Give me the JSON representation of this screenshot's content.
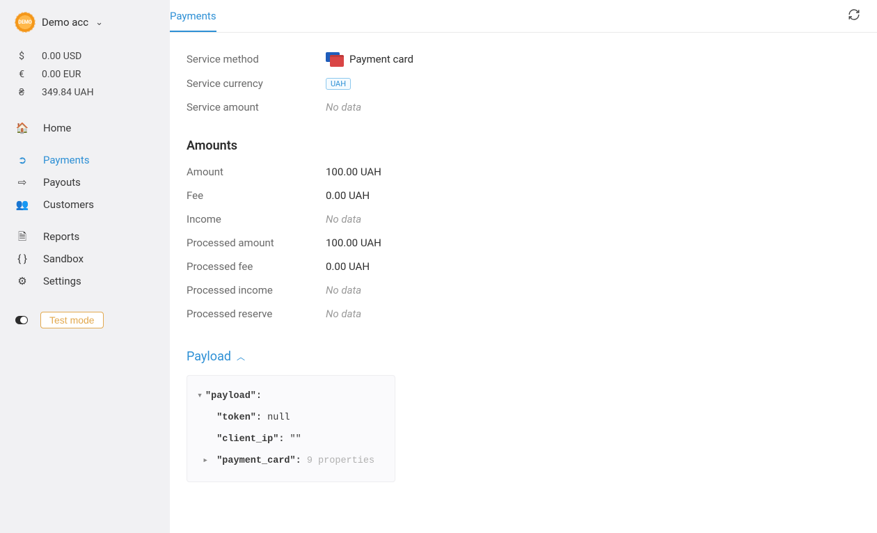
{
  "account": {
    "name": "Demo acc"
  },
  "balances": [
    {
      "icon": "$",
      "text": "0.00 USD"
    },
    {
      "icon": "€",
      "text": "0.00 EUR"
    },
    {
      "icon": "₴",
      "text": "349.84 UAH"
    }
  ],
  "nav": {
    "home": "Home",
    "payments": "Payments",
    "payouts": "Payouts",
    "customers": "Customers",
    "reports": "Reports",
    "sandbox": "Sandbox",
    "settings": "Settings",
    "test_mode": "Test mode"
  },
  "tabs": {
    "payments": "Payments"
  },
  "service": {
    "method_label": "Service method",
    "method_value": "Payment card",
    "currency_label": "Service currency",
    "currency_badge": "UAH",
    "amount_label": "Service amount",
    "amount_value": "No data"
  },
  "amounts": {
    "title": "Amounts",
    "rows": [
      {
        "k": "Amount",
        "v": "100.00 UAH",
        "muted": false
      },
      {
        "k": "Fee",
        "v": "0.00 UAH",
        "muted": false
      },
      {
        "k": "Income",
        "v": "No data",
        "muted": true
      },
      {
        "k": "Processed amount",
        "v": "100.00 UAH",
        "muted": false
      },
      {
        "k": "Processed fee",
        "v": "0.00 UAH",
        "muted": false
      },
      {
        "k": "Processed income",
        "v": "No data",
        "muted": true
      },
      {
        "k": "Processed reserve",
        "v": "No data",
        "muted": true
      }
    ]
  },
  "payload": {
    "title": "Payload",
    "lines": [
      {
        "marker": "▾ ",
        "key": "\"payload\":",
        "val": ""
      },
      {
        "marker": "  ",
        "key": "\"token\":",
        "val": " null"
      },
      {
        "marker": "  ",
        "key": "\"client_ip\":",
        "val": " \"\""
      },
      {
        "marker": " ▸ ",
        "key": "\"payment_card\":",
        "val": "",
        "count": "9 properties"
      }
    ]
  }
}
